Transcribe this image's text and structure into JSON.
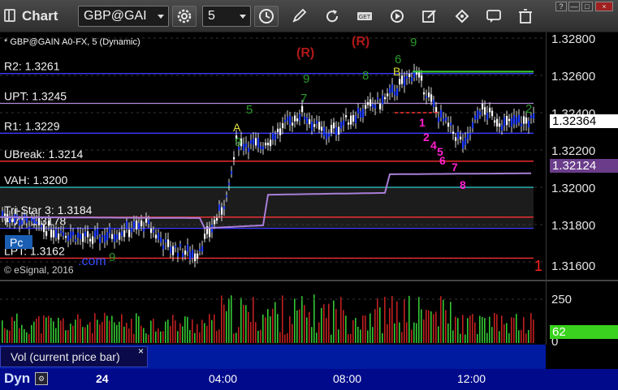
{
  "app": {
    "title": "Chart",
    "logo_icon": "chart-window-icon"
  },
  "toolbar": {
    "symbol": "GBP@GAI",
    "interval": "5",
    "buttons": [
      "settings-gear-icon",
      "clock-icon",
      "pencil-icon",
      "refresh-icon",
      "get-icon",
      "play-icon",
      "edit-icon",
      "tag-icon",
      "speech-icon",
      "trash-icon"
    ],
    "get_label": "GET"
  },
  "window_buttons": [
    "?",
    "—",
    "□",
    "×"
  ],
  "chart": {
    "header": "* GBP@GAIN A0-FX, 5 (Dynamic)",
    "copyright": "© eSignal, 2016",
    "levels": [
      {
        "label": "R2: 1.3261",
        "price": 1.3261,
        "color": "#3a3aff"
      },
      {
        "label": "UPT: 1.3245",
        "price": 1.3245,
        "color": "#b08ad8"
      },
      {
        "label": "R1: 1.3229",
        "price": 1.3229,
        "color": "#3a3aff"
      },
      {
        "label": "UBreak: 1.3214",
        "price": 1.3214,
        "color": "#ff3030"
      },
      {
        "label": "VAH: 1.3200",
        "price": 1.32,
        "color": "#30d0d0"
      },
      {
        "label": "Tri-Star 3: 1.3184",
        "price": 1.3184,
        "color": "#ff3030"
      },
      {
        "label": "PVT: 1.3178",
        "price": 1.3178,
        "color": "#3a3aff"
      },
      {
        "label": "LPT: 1.3162",
        "price": 1.3162,
        "color": "#ff3030"
      }
    ],
    "price_axis": [
      "1.32800",
      "1.32600",
      "1.32400",
      "1.32200",
      "1.32000",
      "1.31800",
      "1.31600"
    ],
    "last_price": "1.32364",
    "ma_price": "1.32124",
    "markers": {
      "r_labels": [
        "(R)",
        "(R)"
      ],
      "b_label": "B",
      "a_label": "A",
      "pink_seq": [
        "1",
        "2",
        "4",
        "5",
        "6",
        "7",
        "8"
      ],
      "green_seq": [
        "9",
        "7",
        "5",
        "9",
        "8",
        "9",
        "6",
        "2",
        "9"
      ],
      "edge_mark": "1",
      "pc_box": "Pc",
      "com_text": ".com"
    }
  },
  "volume": {
    "tab_label": "Vol (current price bar)",
    "axis": [
      "250",
      "0"
    ],
    "current": "62"
  },
  "time_axis": {
    "dyn_label": "Dyn",
    "labels": [
      "24",
      "04:00",
      "08:00",
      "12:00"
    ]
  }
}
